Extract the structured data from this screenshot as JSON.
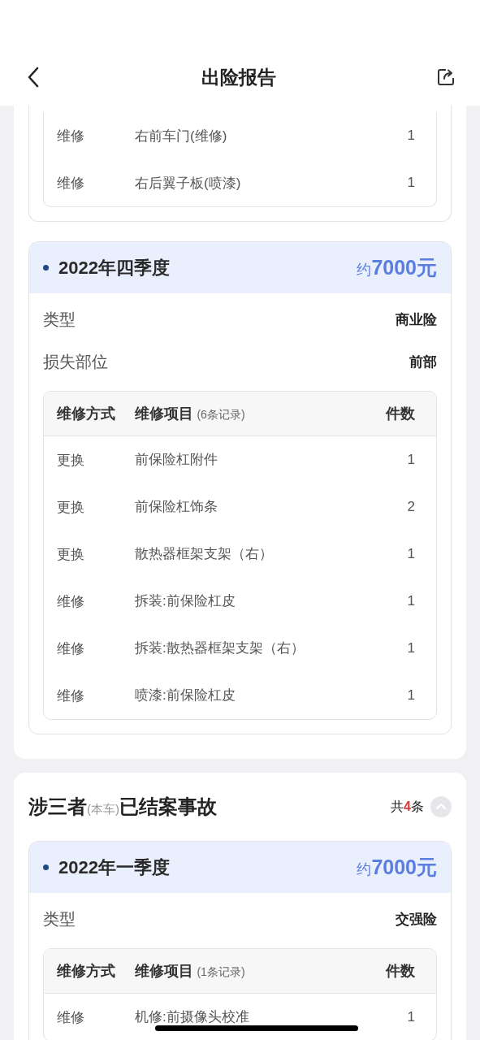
{
  "nav": {
    "title": "出险报告"
  },
  "card_1": {
    "blocks": [
      {
        "kind": "continued",
        "rows": [
          {
            "method": "维修",
            "item": "右前车门(维修)",
            "count": "1"
          },
          {
            "method": "维修",
            "item": "右后翼子板(喷漆)",
            "count": "1"
          }
        ]
      },
      {
        "kind": "accident",
        "period": "2022年四季度",
        "amount_prefix": "约",
        "amount": "7000元",
        "fields": [
          {
            "label": "类型",
            "value": "商业险"
          },
          {
            "label": "损失部位",
            "value": "前部"
          }
        ],
        "table": {
          "columns": [
            "维修方式",
            "维修项目",
            "件数"
          ],
          "record_note": "(6条记录)",
          "rows": [
            {
              "method": "更换",
              "item": "前保险杠附件",
              "count": "1"
            },
            {
              "method": "更换",
              "item": "前保险杠饰条",
              "count": "2"
            },
            {
              "method": "更换",
              "item": "散热器框架支架（右）",
              "count": "1"
            },
            {
              "method": "维修",
              "item": "拆装:前保险杠皮",
              "count": "1"
            },
            {
              "method": "维修",
              "item": "拆装:散热器框架支架（右）",
              "count": "1"
            },
            {
              "method": "维修",
              "item": "喷漆:前保险杠皮",
              "count": "1"
            }
          ]
        }
      }
    ]
  },
  "card_2": {
    "title": "涉三者",
    "title_note": "(本车)",
    "title_tail": "已结案事故",
    "count_prefix": "共",
    "count": "4",
    "count_suffix": "条",
    "expanded": true,
    "blocks": [
      {
        "kind": "accident",
        "period": "2022年一季度",
        "amount_prefix": "约",
        "amount": "7000元",
        "fields": [
          {
            "label": "类型",
            "value": "交强险"
          }
        ],
        "table": {
          "columns": [
            "维修方式",
            "维修项目",
            "件数"
          ],
          "record_note": "(1条记录)",
          "rows": [
            {
              "method": "维修",
              "item": "机修:前摄像头校准",
              "count": "1"
            }
          ]
        }
      }
    ]
  }
}
